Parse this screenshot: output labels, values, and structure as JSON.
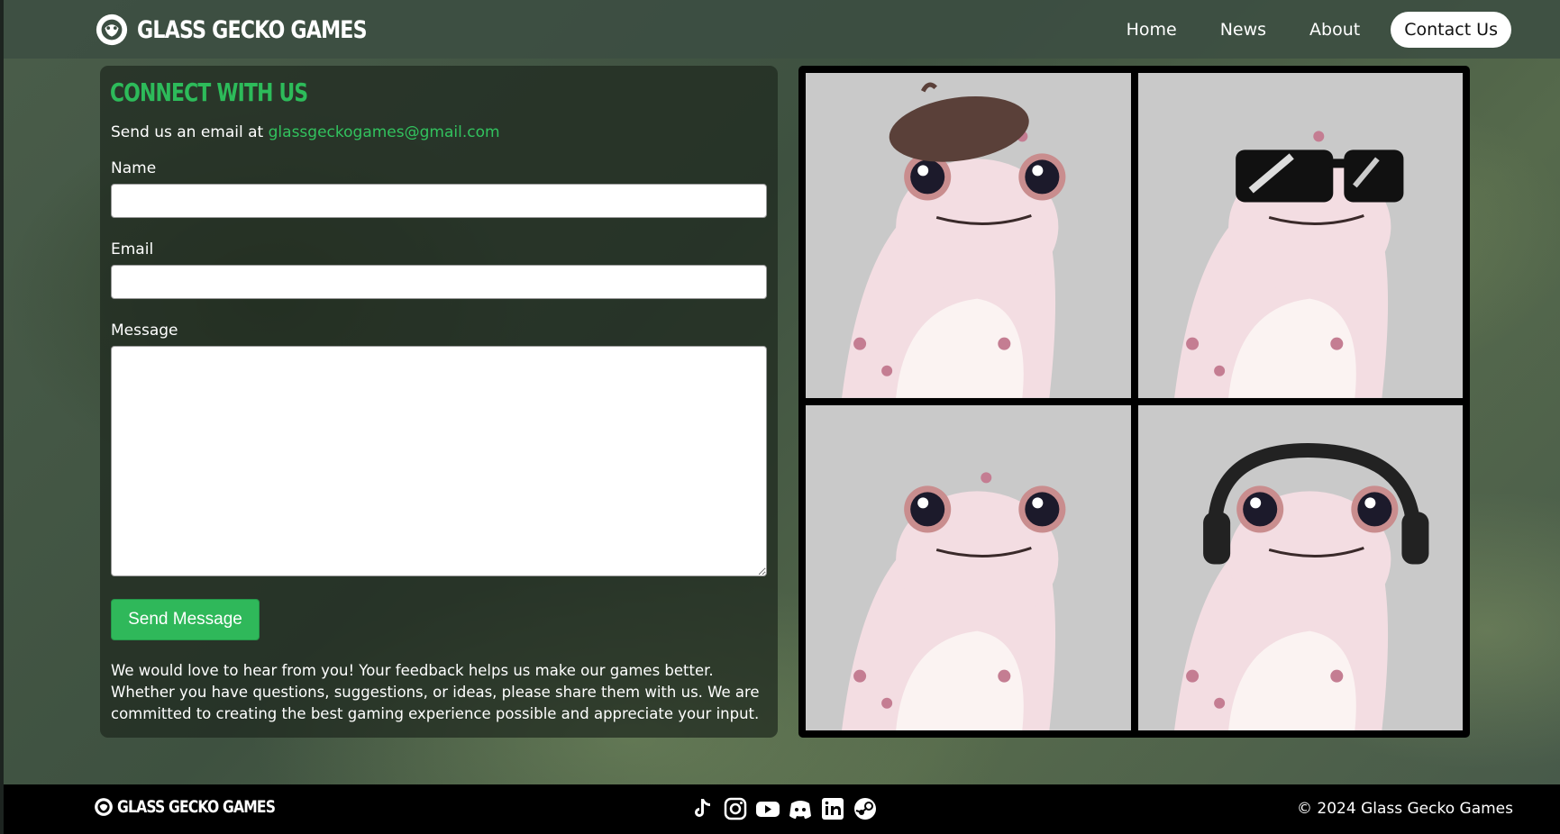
{
  "brand": {
    "name": "GLASS GECKO GAMES"
  },
  "nav": {
    "home": "Home",
    "news": "News",
    "about": "About",
    "contact": "Contact Us"
  },
  "contact": {
    "title": "CONNECT WITH US",
    "intro_prefix": "Send us an email at",
    "email": "glassgeckogames@gmail.com",
    "name_label": "Name",
    "name_value": "",
    "email_label": "Email",
    "email_value": "",
    "message_label": "Message",
    "message_value": "",
    "send_label": "Send Message",
    "paragraph": "We would love to hear from you! Your feedback helps us make our games better. Whether you have questions, suggestions, or ideas, please share them with us. We are committed to creating the best gaming experience possible and appreciate your input."
  },
  "gallery": {
    "items": [
      {
        "accessory": "beret"
      },
      {
        "accessory": "sunglasses"
      },
      {
        "accessory": "none"
      },
      {
        "accessory": "headphones"
      }
    ]
  },
  "footer": {
    "brand": "GLASS GECKO GAMES",
    "copyright": "© 2024 Glass Gecko Games",
    "socials": [
      "tiktok-icon",
      "instagram-icon",
      "youtube-icon",
      "discord-icon",
      "linkedin-icon",
      "steam-icon"
    ]
  },
  "colors": {
    "accent": "#2dbb5a",
    "header_bg": "#3c4e42",
    "footer_bg": "#000000"
  }
}
